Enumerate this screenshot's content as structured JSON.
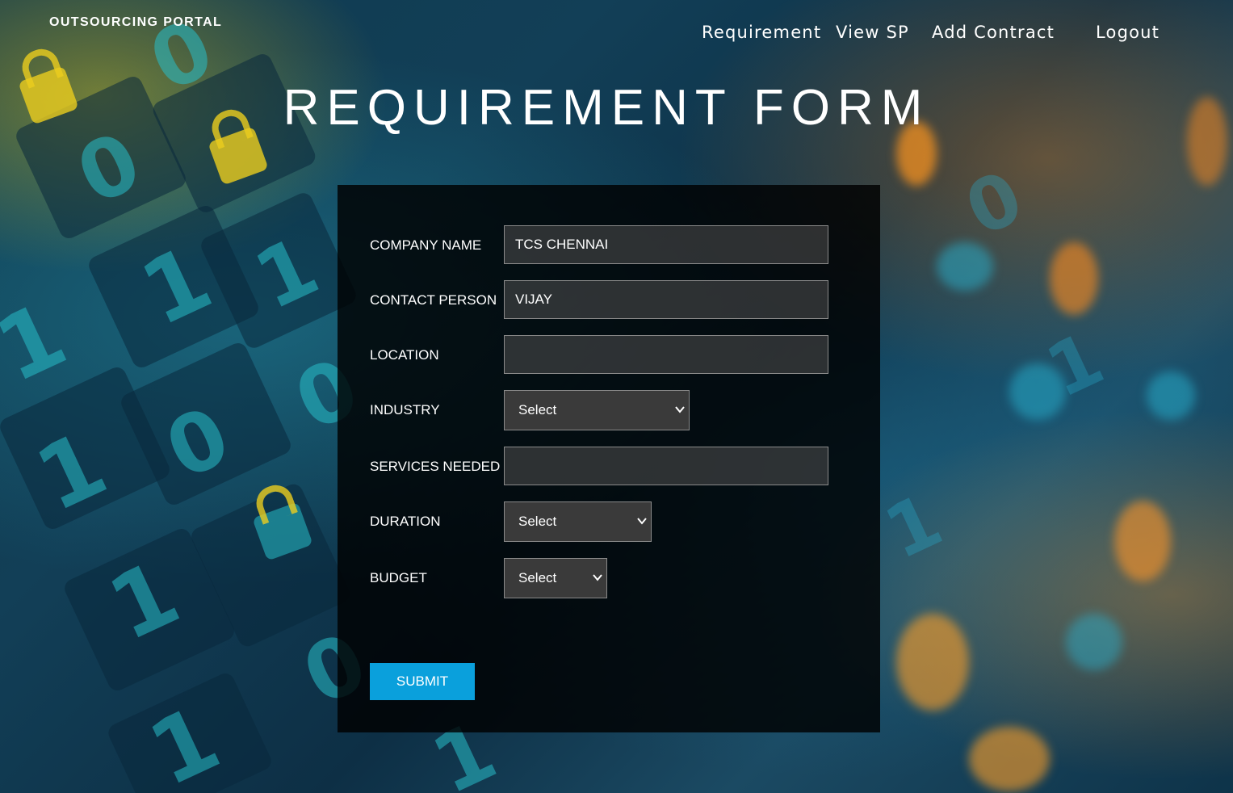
{
  "brand": "OUTSOURCING PORTAL",
  "nav": {
    "items": [
      {
        "label": "Requirement"
      },
      {
        "label": "View SP"
      },
      {
        "label": "Add Contract"
      },
      {
        "label": "Logout"
      }
    ]
  },
  "page_title": "REQUIREMENT FORM",
  "form": {
    "company_name": {
      "label": "COMPANY NAME",
      "value": "TCS CHENNAI"
    },
    "contact_person": {
      "label": "CONTACT PERSON",
      "value": "VIJAY"
    },
    "location": {
      "label": "LOCATION",
      "value": ""
    },
    "industry": {
      "label": "INDUSTRY",
      "selected": "Select"
    },
    "services_needed": {
      "label": "SERVICES NEEDED",
      "value": ""
    },
    "duration": {
      "label": "DURATION",
      "selected": "Select"
    },
    "budget": {
      "label": "BUDGET",
      "selected": "Select"
    },
    "submit_label": "SUBMIT"
  },
  "colors": {
    "accent": "#0aa0dc",
    "panel_bg": "#000000",
    "lock_yellow": "#ebcd1e"
  },
  "background": {
    "digit_glyphs": [
      "0",
      "0",
      "1",
      "1",
      "1",
      "1",
      "0",
      "1",
      "0",
      "1",
      "1",
      "0",
      "1",
      "0",
      "1"
    ]
  }
}
